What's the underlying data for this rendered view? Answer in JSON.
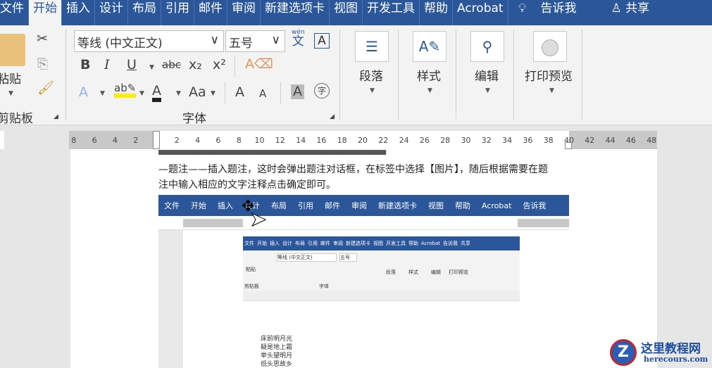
{
  "tabs": [
    "文件",
    "开始",
    "插入",
    "设计",
    "布局",
    "引用",
    "邮件",
    "审阅",
    "新建选项卡",
    "视图",
    "开发工具",
    "帮助",
    "Acrobat"
  ],
  "active_tab": "开始",
  "tell_me": "告诉我",
  "share": "共享",
  "clipboard": {
    "paste": "粘贴",
    "group": "剪贴板"
  },
  "font": {
    "name": "等线 (中文正文)",
    "size": "五号",
    "group": "字体",
    "bold": "B",
    "italic": "I",
    "underline": "U",
    "strike": "abc",
    "sub": "x₂",
    "sup": "x²",
    "grow": "A",
    "shrink": "A",
    "aa": "Aa",
    "phonetic_top": "wén",
    "phonetic": "文"
  },
  "groups": {
    "paragraph": "段落",
    "styles": "样式",
    "editing": "编辑",
    "print_preview": "打印预览"
  },
  "ruler": {
    "left": [
      "8",
      "6",
      "4",
      "2"
    ],
    "main": [
      "2",
      "4",
      "6",
      "8",
      "10",
      "12",
      "14",
      "16",
      "18",
      "20",
      "22",
      "24",
      "26",
      "28",
      "30",
      "32",
      "34",
      "36",
      "38"
    ],
    "right": [
      "40",
      "42",
      "44",
      "46",
      "48"
    ]
  },
  "document": {
    "line2": "—题注——插入题注，这时会弹出题注对话框，在标签中选择【图片】，随后根据需要在题",
    "line3": "注中输入相应的文字注释点击确定即可。"
  },
  "embedded": {
    "tabs": [
      "文件",
      "开始",
      "插入",
      "设计",
      "布局",
      "引用",
      "邮件",
      "审阅",
      "新建选项卡",
      "视图",
      "帮助",
      "Acrobat",
      "告诉我"
    ],
    "inner_tabs": [
      "文件",
      "开始",
      "插入",
      "设计",
      "布局",
      "引用",
      "邮件",
      "审阅",
      "新建选项卡",
      "视图",
      "开发工具",
      "帮助",
      "Acrobat",
      "告诉我",
      "共享"
    ],
    "inner_font": "等线 (中文正文)",
    "inner_size": "五号",
    "inner_groups": [
      "剪贴板",
      "字体",
      "段落",
      "样式",
      "编辑",
      "打印预览"
    ],
    "inner_paste": "粘贴",
    "poem": [
      "床前明月光",
      "疑是地上霜",
      "举头望明月",
      "低头思故乡"
    ]
  },
  "watermark": {
    "name": "这里教程网",
    "url": "herecours.com"
  },
  "colors": {
    "brand": "#2b579a"
  }
}
